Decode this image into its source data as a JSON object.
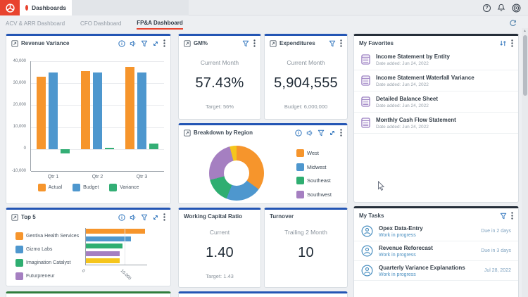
{
  "app": {
    "top_tab": "Dashboards",
    "brand_color": "#e8432e"
  },
  "nav": {
    "tabs": [
      "ACV & ARR Dashboard",
      "CFO Dashboard",
      "FP&A Dashboard"
    ],
    "active_tab": "FP&A Dashboard"
  },
  "widgets": {
    "revenue_variance": {
      "title": "Revenue Variance",
      "chart_data": {
        "type": "bar",
        "categories": [
          "Qtr 1",
          "Qtr 2",
          "Qtr 3"
        ],
        "series": [
          {
            "name": "Actual",
            "color": "#f6952c",
            "values": [
              33000,
              35500,
              37500
            ]
          },
          {
            "name": "Budget",
            "color": "#4e97ce",
            "values": [
              35000,
              35000,
              35000
            ]
          },
          {
            "name": "Variance",
            "color": "#33ae75",
            "values": [
              -2000,
              500,
              2500
            ]
          }
        ],
        "ylim": [
          -10000,
          40000
        ],
        "yticks": [
          40000,
          30000,
          20000,
          10000,
          0,
          -10000
        ],
        "ytick_labels": [
          "40,000",
          "30,000",
          "20,000",
          "10,000",
          "0",
          "-10,000"
        ],
        "legend_position": "bottom",
        "grid": true
      }
    },
    "gm": {
      "title": "GM%",
      "period": "Current Month",
      "value": "57.43%",
      "target": "Target: 56%"
    },
    "expenditures": {
      "title": "Expenditures",
      "period": "Current Month",
      "value": "5,904,555",
      "target": "Budget: 6,000,000"
    },
    "breakdown": {
      "title": "Breakdown by Region",
      "chart_data": {
        "type": "pie",
        "segments": [
          {
            "label": "West",
            "color": "#f6952c",
            "pct": 35
          },
          {
            "label": "Midwest",
            "color": "#4e97ce",
            "pct": 21
          },
          {
            "label": "Southeast",
            "color": "#2fae71",
            "pct": 15
          },
          {
            "label": "Southwest",
            "color": "#a57fc1",
            "pct": 25
          },
          {
            "label": "",
            "color": "#f5c51c",
            "pct": 4
          }
        ],
        "legend_position": "right"
      }
    },
    "favorites": {
      "title": "My Favorites",
      "items": [
        {
          "name": "Income Statement by Entity",
          "date": "Date added: Jun 24, 2022"
        },
        {
          "name": "Income Statement Waterfall Variance",
          "date": "Date added: Jun 24, 2022"
        },
        {
          "name": "Detailed Balance Sheet",
          "date": "Date added: Jun 24, 2022"
        },
        {
          "name": "Monthly Cash Flow Statement",
          "date": "Date added: Jun 24, 2022"
        }
      ]
    },
    "top5": {
      "title": "Top 5",
      "chart_data": {
        "type": "bar-horizontal",
        "series": [
          {
            "name": "Gentiva Health Services",
            "color": "#f6952c",
            "value": 15200
          },
          {
            "name": "Gizmo Labs",
            "color": "#4e97ce",
            "value": 11700
          },
          {
            "name": "Imagination Catalyst",
            "color": "#2fae71",
            "value": 9500
          },
          {
            "name": "Futurpreneur",
            "color": "#a57fc1",
            "value": 8800
          },
          {
            "name": "",
            "color": "#f5c51c",
            "value": 8700
          }
        ],
        "xlim": [
          0,
          16000
        ],
        "xticks": [
          {
            "value": 0,
            "label": "0"
          },
          {
            "value": 10000,
            "label": "10,000"
          }
        ],
        "legend_position": "left"
      }
    },
    "wcr": {
      "title": "Working Capital Ratio",
      "period": "Current",
      "value": "1.40",
      "target": "Target: 1.43"
    },
    "turnover": {
      "title": "Turnover",
      "period": "Trailing 2 Month",
      "value": "10"
    },
    "tasks": {
      "title": "My Tasks",
      "items": [
        {
          "name": "Opex Data-Entry",
          "status": "Work in progress",
          "due": "Due in 2 days"
        },
        {
          "name": "Revenue Reforecast",
          "status": "Work in progress",
          "due": "Due in 3 days"
        },
        {
          "name": "Quarterly Variance Explanations",
          "status": "Work in progress",
          "due": "Jul 28, 2022"
        }
      ]
    }
  },
  "colors": {
    "accent_blue": "#2355b4",
    "accent_dark": "#252e39",
    "accent_green": "#2f7d3c",
    "icon_blue": "#3075bd",
    "brand_red": "#e8432e"
  }
}
